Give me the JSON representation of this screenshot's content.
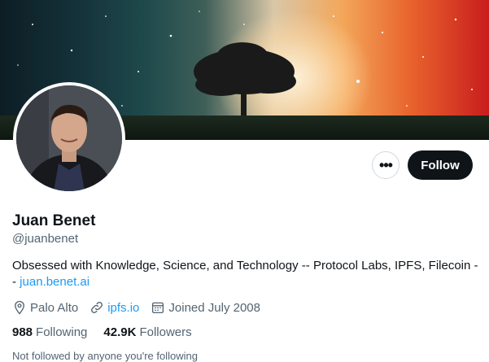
{
  "profile": {
    "name": "Juan Benet",
    "handle": "@juanbenet",
    "bio_text": "Obsessed with Knowledge, Science, and Technology -- Protocol Labs, IPFS, Filecoin -- ",
    "bio_link": "juan.benet.ai",
    "location": "Palo Alto",
    "website": "ipfs.io",
    "joined": "Joined July 2008"
  },
  "actions": {
    "more_label": "•••",
    "follow_label": "Follow"
  },
  "stats": {
    "following_count": "988",
    "following_label": "Following",
    "followers_count": "42.9K",
    "followers_label": "Followers"
  },
  "note": "Not followed by anyone you're following",
  "icons": {
    "location": "location-pin-icon",
    "website": "link-icon",
    "joined": "calendar-icon"
  },
  "colors": {
    "accent": "#1d9bf0",
    "text": "#0f1419",
    "secondary": "#536471",
    "button_dark": "#0f1419"
  }
}
